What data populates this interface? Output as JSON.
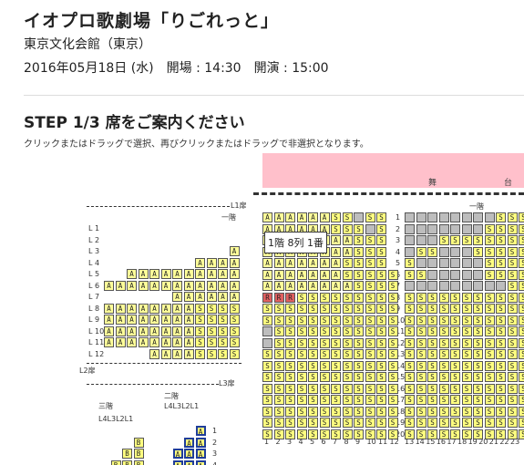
{
  "header": {
    "title": "イオプロ歌劇場「りごれっと」",
    "venue": "東京文化会館（東京）",
    "datetime": "2016年05月18日 (水)　開場 : 14:30　開演 : 15:00"
  },
  "step": {
    "title": "STEP 1/3 席をご案内ください",
    "instruction": "クリックまたはドラッグで選択、再びクリックまたはドラッグで非選択となります。"
  },
  "stage": {
    "label_left": "舞",
    "label_right": "台"
  },
  "labels": {
    "l1door": "L1扉",
    "l2door": "L2扉",
    "l3door": "L3扉",
    "ikkai": "一階",
    "nikai": "二階",
    "sankai": "三階",
    "col_left": "L4L3L2L1",
    "col_mid": "L4L3L2L1",
    "main_ikkai": "一階"
  },
  "left_rows": [
    "L 1",
    "L 2",
    "L 3",
    "L 4",
    "L 5",
    "L 6",
    "L 7",
    "L 8",
    "L 9",
    "L 10",
    "L 11",
    "L 12"
  ],
  "left_seats": [
    "",
    "",
    "A",
    "AAAA",
    "AAAAAAAAAA",
    "AAAAAAAAAAAA",
    "AAAAAA",
    "AAAAAAAASSSS",
    "AAAAAAAASSSS",
    "AAAAAAAASSSS",
    "AAAAAAAASSSS",
    "AAAASSSS"
  ],
  "center_rows": [
    "1",
    "2",
    "3",
    "4",
    "5",
    "6",
    "7",
    "8",
    "9",
    "10",
    "11",
    "12",
    "13",
    "14",
    "15",
    "16",
    "17",
    "18",
    "19",
    "20"
  ],
  "center_seats": [
    "AAAAAASSTSS",
    "AAAAAASSSTS",
    "AAAAAAAASSS",
    "AAAAAAAASSS",
    "AAAAAAASSSS",
    "AAAAAAASSSSS",
    "AAAAAAAASSSS",
    "RRRSSSSSSSSS",
    "SSSSSSSSSSSS",
    "SSSSSSSSSSSS",
    "TSSSSSSSSSSS",
    "TSSSSSSSSSSS",
    "SSSSSSSSSSSS",
    "SSSSSSSSSSSS",
    "SSSSSSSSSSSS",
    "SSSSSSSSSSSS",
    "SSSSSSSSSSSS",
    "SSSSSSSSSSSS",
    "SSSSSSSSSSSS",
    "SSSSSSSSSSSS"
  ],
  "right_seats": [
    "TTTTTTTTSSSS",
    "TTTTTTTSSSSS",
    "TTTSSSSSSSSS",
    "TSSTTTSSSSSS",
    "STTTTTTSSSSS",
    "SSTTTTTSSSSS",
    "TTTTTTTTTSSS",
    "SSSSSSSSSSSS",
    "SSSSSSSSSSSS",
    "SSSSSSSSSSSS",
    "SSSSSSSSSSSS",
    "SSSSSSSSSSSS",
    "SSSSSSSSSSSS",
    "SSSSSSSSSSSS",
    "SSSSSSSSSSSS",
    "SSSSSSSSSSSS",
    "SSSSSSSSSSSS",
    "SSSSSSSSSSSS",
    "SSSSSSSSSSSS",
    "SSSSSSSSSSSS"
  ],
  "center_cols": [
    "1",
    "2",
    "3",
    "4",
    "5",
    "6",
    "7",
    "8",
    "9",
    "10",
    "11",
    "12"
  ],
  "right_cols": [
    "13",
    "14",
    "15",
    "16",
    "17",
    "18",
    "19",
    "20",
    "21",
    "22",
    "23"
  ],
  "tooltip": "1階 8列 1番",
  "balcony_rows": [
    "1",
    "2",
    "3",
    "4"
  ],
  "colors": {
    "stage": "#ffc0cb",
    "seat_a": "#ffff80",
    "taken": "#bdbdbd",
    "selected": "#e06060",
    "green": "#a7e08a"
  }
}
